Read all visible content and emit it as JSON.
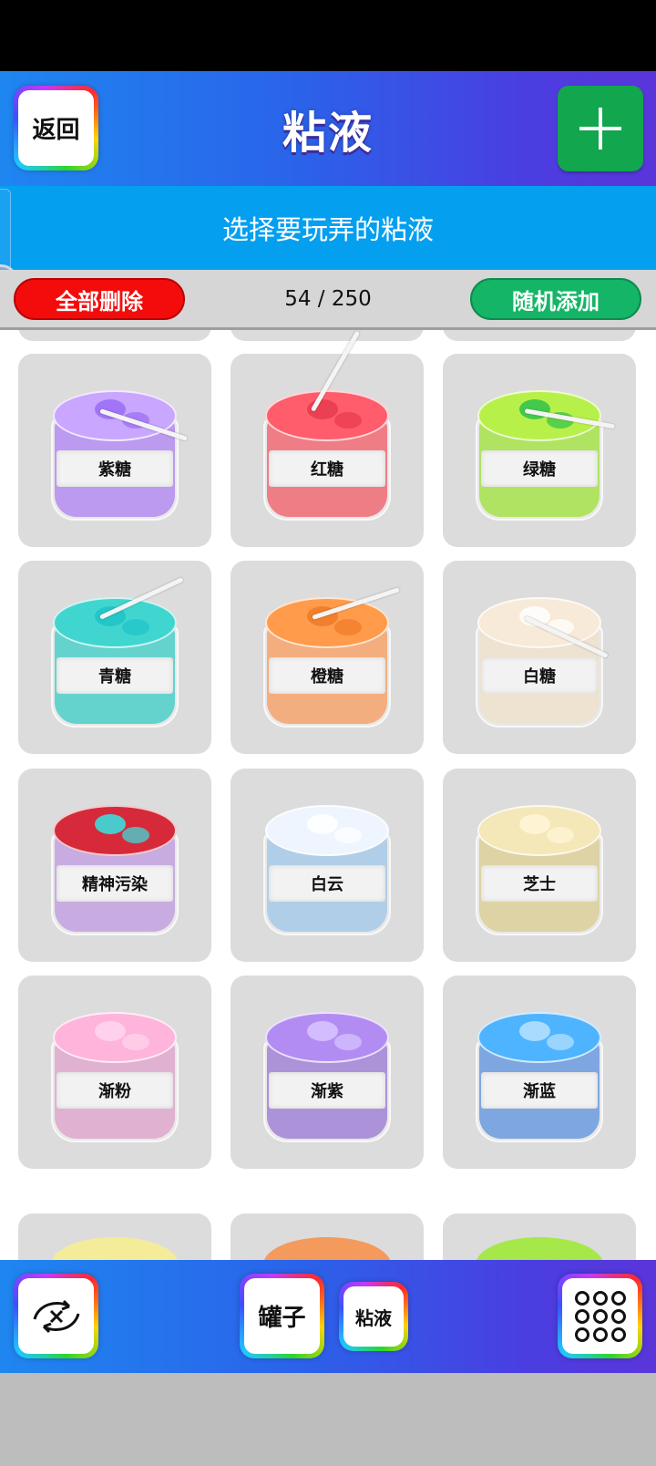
{
  "header": {
    "back_label": "返回",
    "title": "粘液",
    "add_icon": "plus-icon"
  },
  "subheader": {
    "text": "选择要玩弄的粘液"
  },
  "toolbar": {
    "delete_all_label": "全部删除",
    "count": "54 / 250",
    "random_add_label": "随机添加"
  },
  "slimes": [
    {
      "name": "紫糖",
      "color": "#b48cf0",
      "top_color": "#c9a6ff",
      "accent": "#9b6cf4"
    },
    {
      "name": "红糖",
      "color": "#f06a74",
      "top_color": "#ff5d6c",
      "accent": "#e8394d"
    },
    {
      "name": "绿糖",
      "color": "#a6e24a",
      "top_color": "#b8f04a",
      "accent": "#2fc24a"
    },
    {
      "name": "青糖",
      "color": "#4dcfc8",
      "top_color": "#40d6cf",
      "accent": "#1ec3c8"
    },
    {
      "name": "橙糖",
      "color": "#f5a36c",
      "top_color": "#ff9b4a",
      "accent": "#ef7a28"
    },
    {
      "name": "白糖",
      "color": "#efe1cd",
      "top_color": "#f7ead8",
      "accent": "#ffffff"
    },
    {
      "name": "精神污染",
      "color": "#c3a2e0",
      "top_color": "#d62a3a",
      "accent": "#33e6e6"
    },
    {
      "name": "白云",
      "color": "#a7c9e8",
      "top_color": "#eef5ff",
      "accent": "#ffffff"
    },
    {
      "name": "芝士",
      "color": "#dccf98",
      "top_color": "#f4e7b8",
      "accent": "#fff6d8"
    },
    {
      "name": "渐粉",
      "color": "#e0a7cd",
      "top_color": "#ffb4dc",
      "accent": "#ffd6ec"
    },
    {
      "name": "渐紫",
      "color": "#a283d6",
      "top_color": "#b38cf3",
      "accent": "#d8c6ff"
    },
    {
      "name": "渐蓝",
      "color": "#6b9be0",
      "top_color": "#4fb4ff",
      "accent": "#b9e2ff"
    }
  ],
  "bottom": {
    "sync_icon": "swap-arrows-icon",
    "jar_label": "罐子",
    "slime_label": "粘液",
    "grid_icon": "grid-circles-icon"
  }
}
